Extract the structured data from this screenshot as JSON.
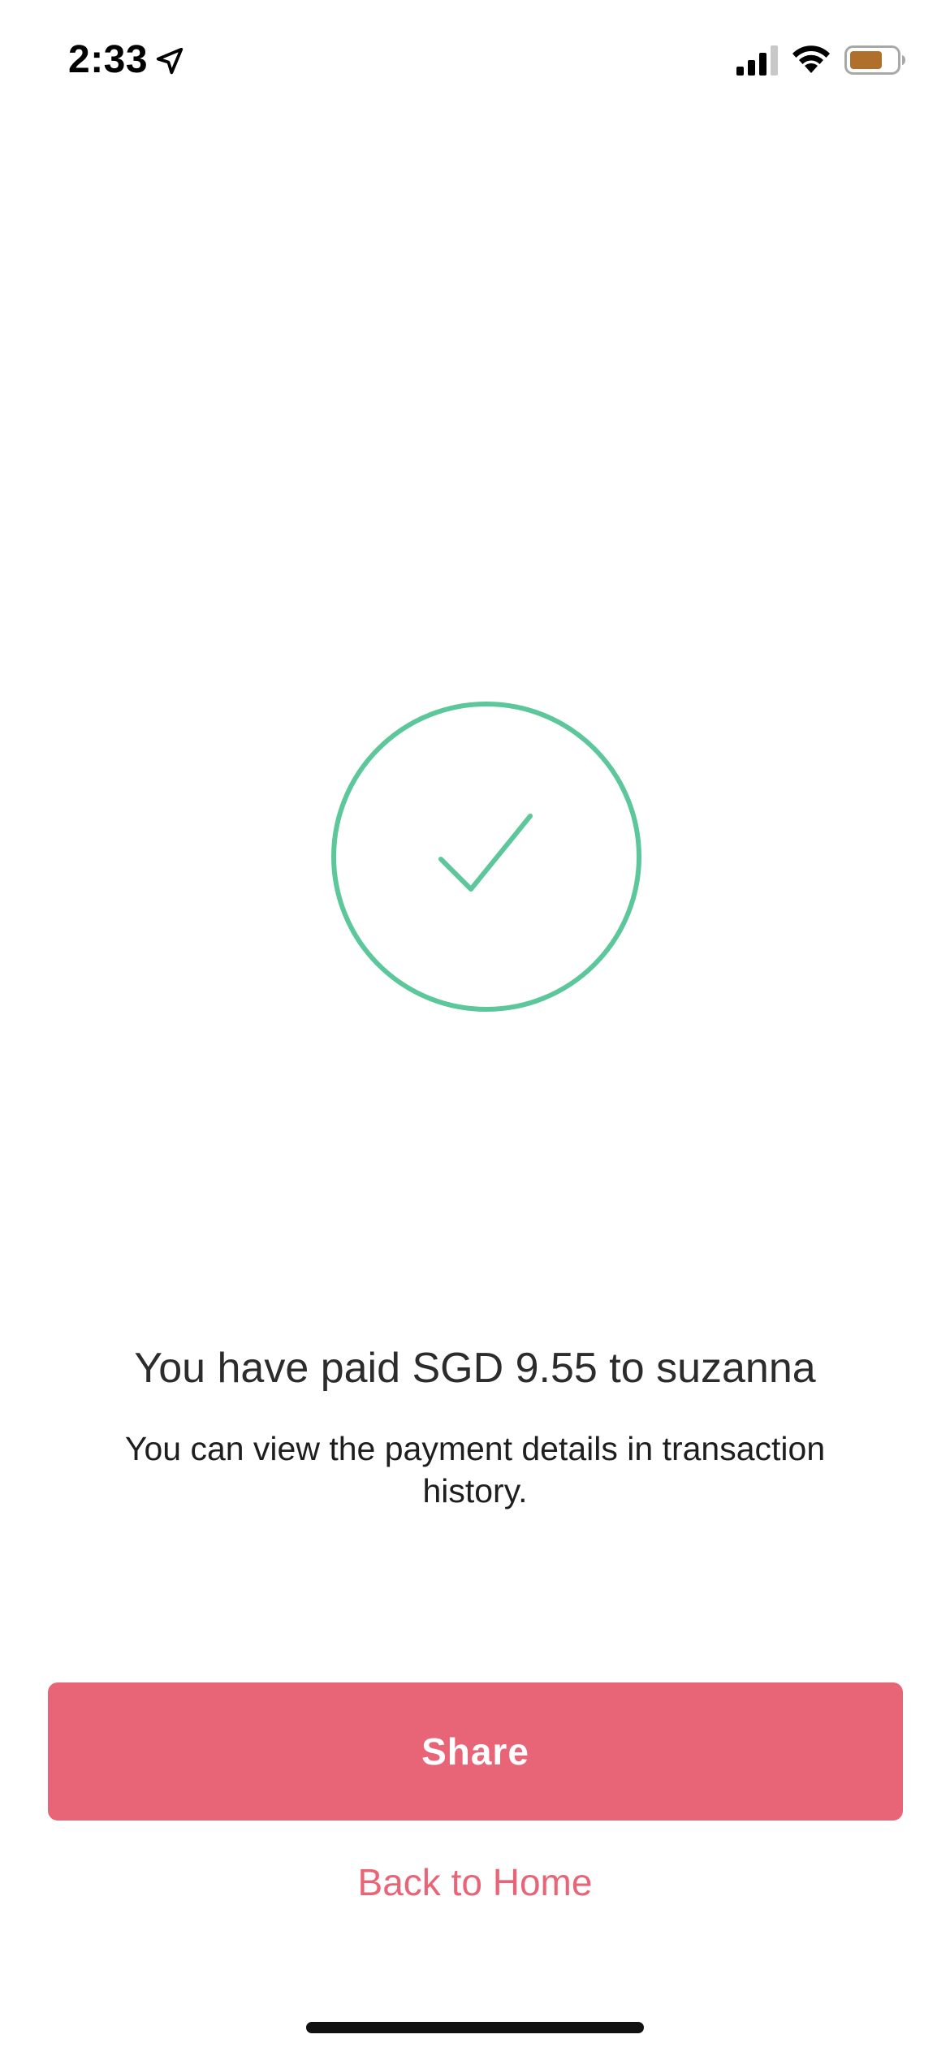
{
  "status_bar": {
    "time": "2:33",
    "icons": [
      "location-arrow-icon",
      "cellular-signal-icon",
      "wifi-icon",
      "battery-icon"
    ],
    "battery_color": "#b06f2b"
  },
  "success": {
    "icon": "checkmark-circle-icon",
    "accent_color": "#5cc79a"
  },
  "message": {
    "headline": "You have paid SGD 9.55 to suzanna",
    "details": "You can view the payment details in transaction history."
  },
  "actions": {
    "share_label": "Share",
    "back_home_label": "Back to Home",
    "primary_color": "#e86577"
  }
}
